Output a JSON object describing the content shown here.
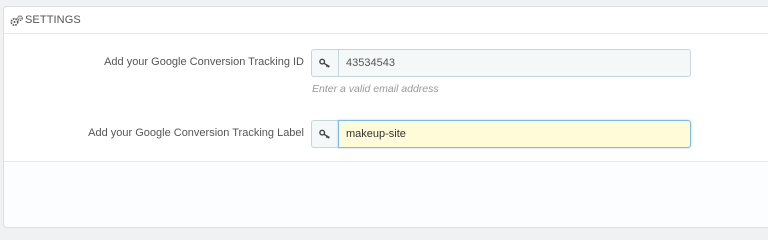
{
  "panel": {
    "title": "SETTINGS",
    "icon": "cogs-icon"
  },
  "fields": [
    {
      "label": "Add your Google Conversion Tracking ID",
      "icon": "key-icon",
      "value": "43534543",
      "help": "Enter a valid email address"
    },
    {
      "label": "Add your Google Conversion Tracking Label",
      "icon": "key-icon",
      "value": "makeup-site"
    }
  ],
  "colors": {
    "active_field_bg": "#fffbd9",
    "active_field_border": "#7bbde0",
    "field_bg": "#f5f8f9"
  }
}
